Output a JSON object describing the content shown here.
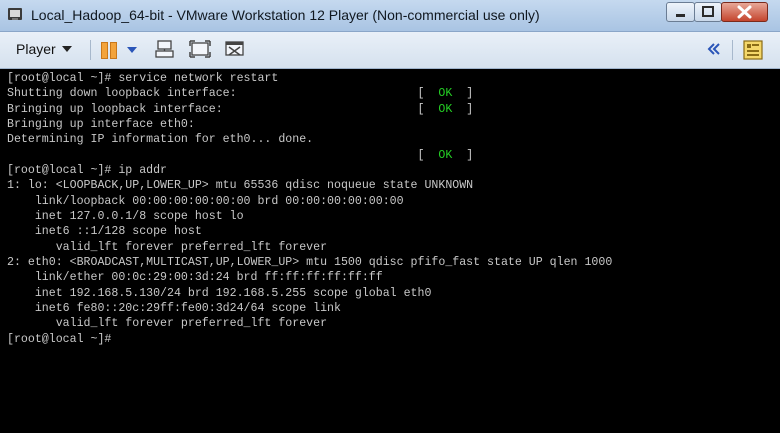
{
  "window": {
    "title": "Local_Hadoop_64-bit - VMware Workstation 12 Player (Non-commercial use only)"
  },
  "toolbar": {
    "player_label": "Player",
    "icons": [
      "pause-icon",
      "dropdown-arrow-icon",
      "send-ctrl-alt-del-icon",
      "fullscreen-icon",
      "unity-icon",
      "collapse-icon",
      "library-icon"
    ]
  },
  "colors": {
    "ok_green": "#25d025",
    "terminal_bg": "#000000",
    "terminal_fg": "#c8c8c8"
  },
  "terminal": {
    "lines": [
      {
        "text": "[root@local ~]# service network restart"
      },
      {
        "text": "Shutting down loopback interface:                          [  ",
        "ok": "OK",
        "tail": "  ]"
      },
      {
        "text": "Bringing up loopback interface:                            [  ",
        "ok": "OK",
        "tail": "  ]"
      },
      {
        "text": "Bringing up interface eth0:"
      },
      {
        "text": "Determining IP information for eth0... done."
      },
      {
        "text": "                                                           [  ",
        "ok": "OK",
        "tail": "  ]"
      },
      {
        "text": "[root@local ~]# ip addr"
      },
      {
        "text": "1: lo: <LOOPBACK,UP,LOWER_UP> mtu 65536 qdisc noqueue state UNKNOWN"
      },
      {
        "text": "    link/loopback 00:00:00:00:00:00 brd 00:00:00:00:00:00"
      },
      {
        "text": "    inet 127.0.0.1/8 scope host lo"
      },
      {
        "text": "    inet6 ::1/128 scope host"
      },
      {
        "text": "       valid_lft forever preferred_lft forever"
      },
      {
        "text": "2: eth0: <BROADCAST,MULTICAST,UP,LOWER_UP> mtu 1500 qdisc pfifo_fast state UP qlen 1000"
      },
      {
        "text": "    link/ether 00:0c:29:00:3d:24 brd ff:ff:ff:ff:ff:ff"
      },
      {
        "text": "    inet 192.168.5.130/24 brd 192.168.5.255 scope global eth0"
      },
      {
        "text": "    inet6 fe80::20c:29ff:fe00:3d24/64 scope link"
      },
      {
        "text": "       valid_lft forever preferred_lft forever"
      },
      {
        "text": "[root@local ~]#"
      }
    ]
  }
}
